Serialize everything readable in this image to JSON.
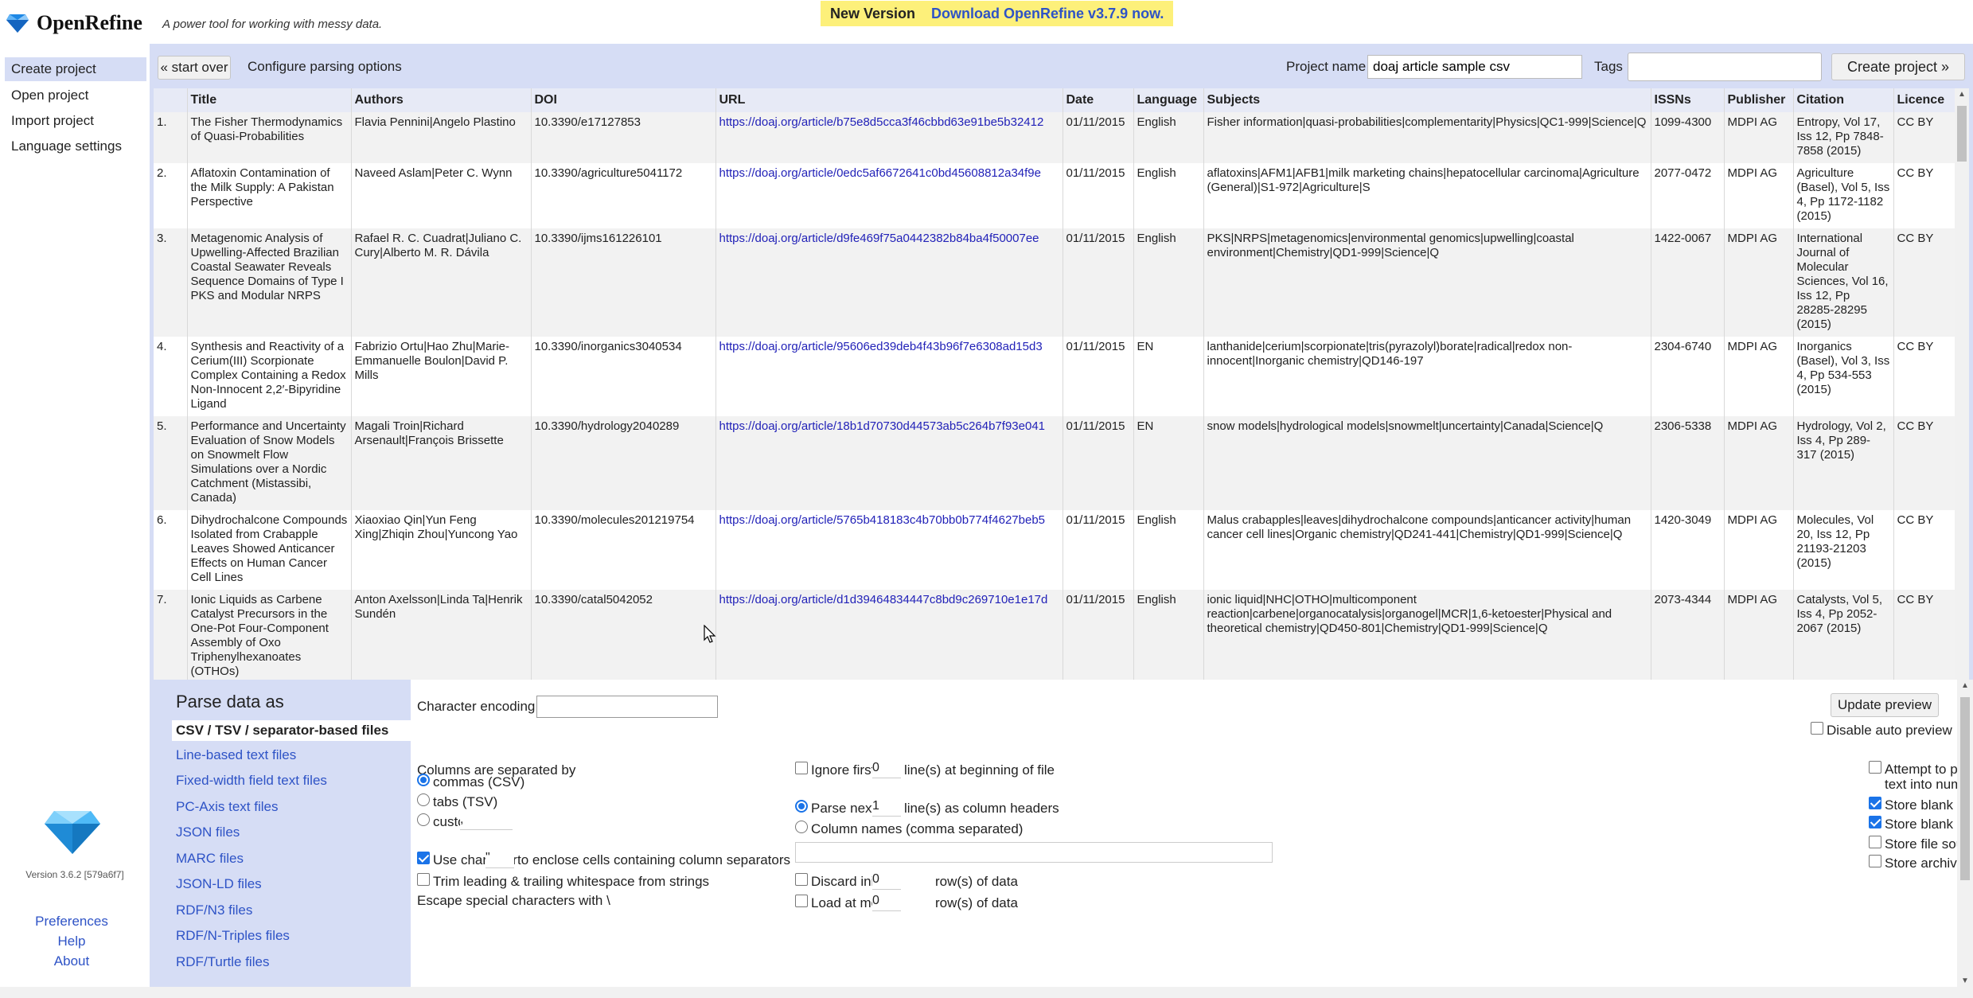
{
  "app": {
    "name": "OpenRefine",
    "tagline": "A power tool for working with messy data.",
    "notice_new": "New Version",
    "notice_download": "Download OpenRefine v3.7.9 now.",
    "version": "Version 3.6.2 [579a6f7]"
  },
  "nav": {
    "items": [
      "Create project",
      "Open project",
      "Import project",
      "Language settings"
    ],
    "bottom": [
      "Preferences",
      "Help",
      "About"
    ]
  },
  "toolbar": {
    "start_over": "« start over",
    "title": "Configure parsing options",
    "project_name_label": "Project name",
    "project_name_value": "doaj article sample csv",
    "tags_label": "Tags",
    "create_button": "Create project »"
  },
  "table": {
    "columns": [
      "",
      "Title",
      "Authors",
      "DOI",
      "URL",
      "Date",
      "Language",
      "Subjects",
      "ISSNs",
      "Publisher",
      "Citation",
      "Licence"
    ],
    "rows": [
      [
        "1.",
        "The Fisher Thermodynamics of Quasi-Probabilities",
        "Flavia Pennini|Angelo Plastino",
        "10.3390/e17127853",
        "https://doaj.org/article/b75e8d5cca3f46cbbd63e91be5b32412",
        "01/11/2015",
        "English",
        "Fisher information|quasi-probabilities|complementarity|Physics|QC1-999|Science|Q",
        "1099-4300",
        "MDPI AG",
        "Entropy, Vol 17, Iss 12, Pp 7848-7858 (2015)",
        "CC BY"
      ],
      [
        "2.",
        "Aflatoxin Contamination of the Milk Supply: A Pakistan Perspective",
        "Naveed Aslam|Peter C. Wynn",
        "10.3390/agriculture5041172",
        "https://doaj.org/article/0edc5af6672641c0bd45608812a34f9e",
        "01/11/2015",
        "English",
        "aflatoxins|AFM1|AFB1|milk marketing chains|hepatocellular carcinoma|Agriculture (General)|S1-972|Agriculture|S",
        "2077-0472",
        "MDPI AG",
        "Agriculture (Basel), Vol 5, Iss 4, Pp 1172-1182 (2015)",
        "CC BY"
      ],
      [
        "3.",
        "Metagenomic Analysis of Upwelling-Affected Brazilian Coastal Seawater Reveals Sequence Domains of Type I PKS and Modular NRPS",
        "Rafael R. C. Cuadrat|Juliano C. Cury|Alberto M. R. Dávila",
        "10.3390/ijms161226101",
        "https://doaj.org/article/d9fe469f75a0442382b84ba4f50007ee",
        "01/11/2015",
        "English",
        "PKS|NRPS|metagenomics|environmental genomics|upwelling|coastal environment|Chemistry|QD1-999|Science|Q",
        "1422-0067",
        "MDPI AG",
        "International Journal of Molecular Sciences, Vol 16, Iss 12, Pp 28285-28295 (2015)",
        "CC BY"
      ],
      [
        "4.",
        "Synthesis and Reactivity of a Cerium(III) Scorpionate Complex Containing a Redox Non-Innocent 2,2′-Bipyridine Ligand",
        "Fabrizio Ortu|Hao Zhu|Marie-Emmanuelle Boulon|David P. Mills",
        "10.3390/inorganics3040534",
        "https://doaj.org/article/95606ed39deb4f43b96f7e6308ad15d3",
        "01/11/2015",
        "EN",
        "lanthanide|cerium|scorpionate|tris(pyrazolyl)borate|radical|redox non-innocent|Inorganic chemistry|QD146-197",
        "2304-6740",
        "MDPI AG",
        "Inorganics (Basel), Vol 3, Iss 4, Pp 534-553 (2015)",
        "CC BY"
      ],
      [
        "5.",
        "Performance and Uncertainty Evaluation of Snow Models on Snowmelt Flow Simulations over a Nordic Catchment (Mistassibi, Canada)",
        "Magali Troin|Richard Arsenault|François Brissette",
        "10.3390/hydrology2040289",
        "https://doaj.org/article/18b1d70730d44573ab5c264b7f93e041",
        "01/11/2015",
        "EN",
        "snow models|hydrological models|snowmelt|uncertainty|Canada|Science|Q",
        "2306-5338",
        "MDPI AG",
        "Hydrology, Vol 2, Iss 4, Pp 289-317 (2015)",
        "CC BY"
      ],
      [
        "6.",
        "Dihydrochalcone Compounds Isolated from Crabapple Leaves Showed Anticancer Effects on Human Cancer Cell Lines",
        "Xiaoxiao Qin|Yun Feng Xing|Zhiqin Zhou|Yuncong Yao",
        "10.3390/molecules201219754",
        "https://doaj.org/article/5765b418183c4b70bb0b774f4627beb5",
        "01/11/2015",
        "English",
        "Malus crabapples|leaves|dihydrochalcone compounds|anticancer activity|human cancer cell lines|Organic chemistry|QD241-441|Chemistry|QD1-999|Science|Q",
        "1420-3049",
        "MDPI AG",
        "Molecules, Vol 20, Iss 12, Pp 21193-21203 (2015)",
        "CC BY"
      ],
      [
        "7.",
        "Ionic Liquids as Carbene Catalyst Precursors in the One-Pot Four-Component Assembly of Oxo Triphenylhexanoates (OTHOs)",
        "Anton Axelsson|Linda Ta|Henrik Sundén",
        "10.3390/catal5042052",
        "https://doaj.org/article/d1d39464834447c8bd9c269710e1e17d",
        "01/11/2015",
        "English",
        "ionic liquid|NHC|OTHO|multicomponent reaction|carbene|organocatalysis|organogel|MCR|1,6-ketoester|Physical and theoretical chemistry|QD450-801|Chemistry|QD1-999|Science|Q",
        "2073-4344",
        "MDPI AG",
        "Catalysts, Vol 5, Iss 4, Pp 2052-2067 (2015)",
        "CC BY"
      ]
    ]
  },
  "parse": {
    "title": "Parse data as",
    "formats": [
      "CSV / TSV / separator-based files",
      "Line-based text files",
      "Fixed-width field text files",
      "PC-Axis text files",
      "JSON files",
      "MARC files",
      "JSON-LD files",
      "RDF/N3 files",
      "RDF/N-Triples files",
      "RDF/Turtle files"
    ],
    "char_encoding": "Character encoding",
    "update_preview": "Update preview",
    "disable_auto_preview": "Disable auto preview",
    "cols_separated_by": "Columns are separated by",
    "sep_commas": "commas (CSV)",
    "sep_tabs": "tabs (TSV)",
    "sep_custom": "custom",
    "custom_value": ",",
    "use_char": "Use character",
    "quote_char": "\"",
    "use_char_suffix": "to enclose cells containing column separators",
    "trim": "Trim leading & trailing whitespace from strings",
    "escape": "Escape special characters with \\",
    "ignore_first": "Ignore first",
    "ignore_value": "0",
    "ignore_suffix": "line(s) at beginning of file",
    "parse_next": "Parse next",
    "parse_value": "1",
    "parse_suffix": "line(s) as column headers",
    "column_names": "Column names (comma separated)",
    "discard_initial": "Discard initial",
    "discard_value": "0",
    "discard_suffix": "row(s) of data",
    "load_at_most": "Load at most",
    "load_value": "0",
    "load_suffix": "row(s) of data",
    "attempt_parse_1": "Attempt to parse cell",
    "attempt_parse_2": "text into numbers",
    "store_blank_rows": "Store blank rows",
    "store_blank_nulls": "Store blank cells as nulls",
    "store_file_source": "Store file source",
    "store_archive": "Store archive file"
  },
  "colors": {
    "panel_bg": "#d6ddf5",
    "link": "#2e53c6",
    "notice_bg": "#fdf07a",
    "check": "#1a73e8"
  }
}
